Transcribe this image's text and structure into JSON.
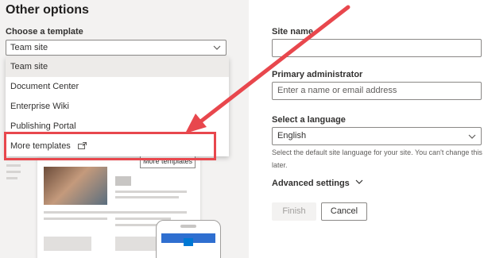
{
  "left": {
    "title": "Other options",
    "template_label": "Choose a template",
    "template_selected": "Team site",
    "dropdown": {
      "items": [
        {
          "label": "Team site",
          "selected": true
        },
        {
          "label": "Document Center",
          "selected": false
        },
        {
          "label": "Enterprise Wiki",
          "selected": false
        },
        {
          "label": "Publishing Portal",
          "selected": false
        },
        {
          "label": "More templates",
          "selected": false,
          "icon": "external-link-icon"
        }
      ]
    },
    "preview": {
      "more_templates_button": "More templates"
    }
  },
  "right": {
    "site_name_label": "Site name",
    "site_name_value": "",
    "admin_label": "Primary administrator",
    "admin_placeholder": "Enter a name or email address",
    "language_label": "Select a language",
    "language_value": "English",
    "language_hint": "Select the default site language for your site. You can't change this later.",
    "advanced_label": "Advanced settings",
    "finish_label": "Finish",
    "cancel_label": "Cancel"
  },
  "colors": {
    "highlight": "#e8474d",
    "accent": "#0078d4",
    "panel_gray": "#f3f2f1"
  }
}
